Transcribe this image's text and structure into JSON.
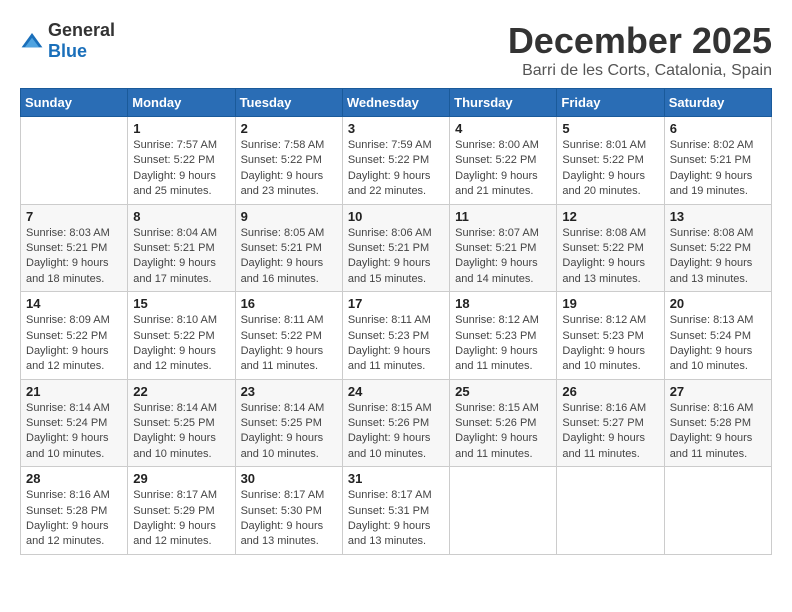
{
  "logo": {
    "general": "General",
    "blue": "Blue"
  },
  "title": "December 2025",
  "location": "Barri de les Corts, Catalonia, Spain",
  "headers": [
    "Sunday",
    "Monday",
    "Tuesday",
    "Wednesday",
    "Thursday",
    "Friday",
    "Saturday"
  ],
  "weeks": [
    [
      {
        "day": "",
        "info": ""
      },
      {
        "day": "1",
        "info": "Sunrise: 7:57 AM\nSunset: 5:22 PM\nDaylight: 9 hours and 25 minutes."
      },
      {
        "day": "2",
        "info": "Sunrise: 7:58 AM\nSunset: 5:22 PM\nDaylight: 9 hours and 23 minutes."
      },
      {
        "day": "3",
        "info": "Sunrise: 7:59 AM\nSunset: 5:22 PM\nDaylight: 9 hours and 22 minutes."
      },
      {
        "day": "4",
        "info": "Sunrise: 8:00 AM\nSunset: 5:22 PM\nDaylight: 9 hours and 21 minutes."
      },
      {
        "day": "5",
        "info": "Sunrise: 8:01 AM\nSunset: 5:22 PM\nDaylight: 9 hours and 20 minutes."
      },
      {
        "day": "6",
        "info": "Sunrise: 8:02 AM\nSunset: 5:21 PM\nDaylight: 9 hours and 19 minutes."
      }
    ],
    [
      {
        "day": "7",
        "info": "Sunrise: 8:03 AM\nSunset: 5:21 PM\nDaylight: 9 hours and 18 minutes."
      },
      {
        "day": "8",
        "info": "Sunrise: 8:04 AM\nSunset: 5:21 PM\nDaylight: 9 hours and 17 minutes."
      },
      {
        "day": "9",
        "info": "Sunrise: 8:05 AM\nSunset: 5:21 PM\nDaylight: 9 hours and 16 minutes."
      },
      {
        "day": "10",
        "info": "Sunrise: 8:06 AM\nSunset: 5:21 PM\nDaylight: 9 hours and 15 minutes."
      },
      {
        "day": "11",
        "info": "Sunrise: 8:07 AM\nSunset: 5:21 PM\nDaylight: 9 hours and 14 minutes."
      },
      {
        "day": "12",
        "info": "Sunrise: 8:08 AM\nSunset: 5:22 PM\nDaylight: 9 hours and 13 minutes."
      },
      {
        "day": "13",
        "info": "Sunrise: 8:08 AM\nSunset: 5:22 PM\nDaylight: 9 hours and 13 minutes."
      }
    ],
    [
      {
        "day": "14",
        "info": "Sunrise: 8:09 AM\nSunset: 5:22 PM\nDaylight: 9 hours and 12 minutes."
      },
      {
        "day": "15",
        "info": "Sunrise: 8:10 AM\nSunset: 5:22 PM\nDaylight: 9 hours and 12 minutes."
      },
      {
        "day": "16",
        "info": "Sunrise: 8:11 AM\nSunset: 5:22 PM\nDaylight: 9 hours and 11 minutes."
      },
      {
        "day": "17",
        "info": "Sunrise: 8:11 AM\nSunset: 5:23 PM\nDaylight: 9 hours and 11 minutes."
      },
      {
        "day": "18",
        "info": "Sunrise: 8:12 AM\nSunset: 5:23 PM\nDaylight: 9 hours and 11 minutes."
      },
      {
        "day": "19",
        "info": "Sunrise: 8:12 AM\nSunset: 5:23 PM\nDaylight: 9 hours and 10 minutes."
      },
      {
        "day": "20",
        "info": "Sunrise: 8:13 AM\nSunset: 5:24 PM\nDaylight: 9 hours and 10 minutes."
      }
    ],
    [
      {
        "day": "21",
        "info": "Sunrise: 8:14 AM\nSunset: 5:24 PM\nDaylight: 9 hours and 10 minutes."
      },
      {
        "day": "22",
        "info": "Sunrise: 8:14 AM\nSunset: 5:25 PM\nDaylight: 9 hours and 10 minutes."
      },
      {
        "day": "23",
        "info": "Sunrise: 8:14 AM\nSunset: 5:25 PM\nDaylight: 9 hours and 10 minutes."
      },
      {
        "day": "24",
        "info": "Sunrise: 8:15 AM\nSunset: 5:26 PM\nDaylight: 9 hours and 10 minutes."
      },
      {
        "day": "25",
        "info": "Sunrise: 8:15 AM\nSunset: 5:26 PM\nDaylight: 9 hours and 11 minutes."
      },
      {
        "day": "26",
        "info": "Sunrise: 8:16 AM\nSunset: 5:27 PM\nDaylight: 9 hours and 11 minutes."
      },
      {
        "day": "27",
        "info": "Sunrise: 8:16 AM\nSunset: 5:28 PM\nDaylight: 9 hours and 11 minutes."
      }
    ],
    [
      {
        "day": "28",
        "info": "Sunrise: 8:16 AM\nSunset: 5:28 PM\nDaylight: 9 hours and 12 minutes."
      },
      {
        "day": "29",
        "info": "Sunrise: 8:17 AM\nSunset: 5:29 PM\nDaylight: 9 hours and 12 minutes."
      },
      {
        "day": "30",
        "info": "Sunrise: 8:17 AM\nSunset: 5:30 PM\nDaylight: 9 hours and 13 minutes."
      },
      {
        "day": "31",
        "info": "Sunrise: 8:17 AM\nSunset: 5:31 PM\nDaylight: 9 hours and 13 minutes."
      },
      {
        "day": "",
        "info": ""
      },
      {
        "day": "",
        "info": ""
      },
      {
        "day": "",
        "info": ""
      }
    ]
  ]
}
